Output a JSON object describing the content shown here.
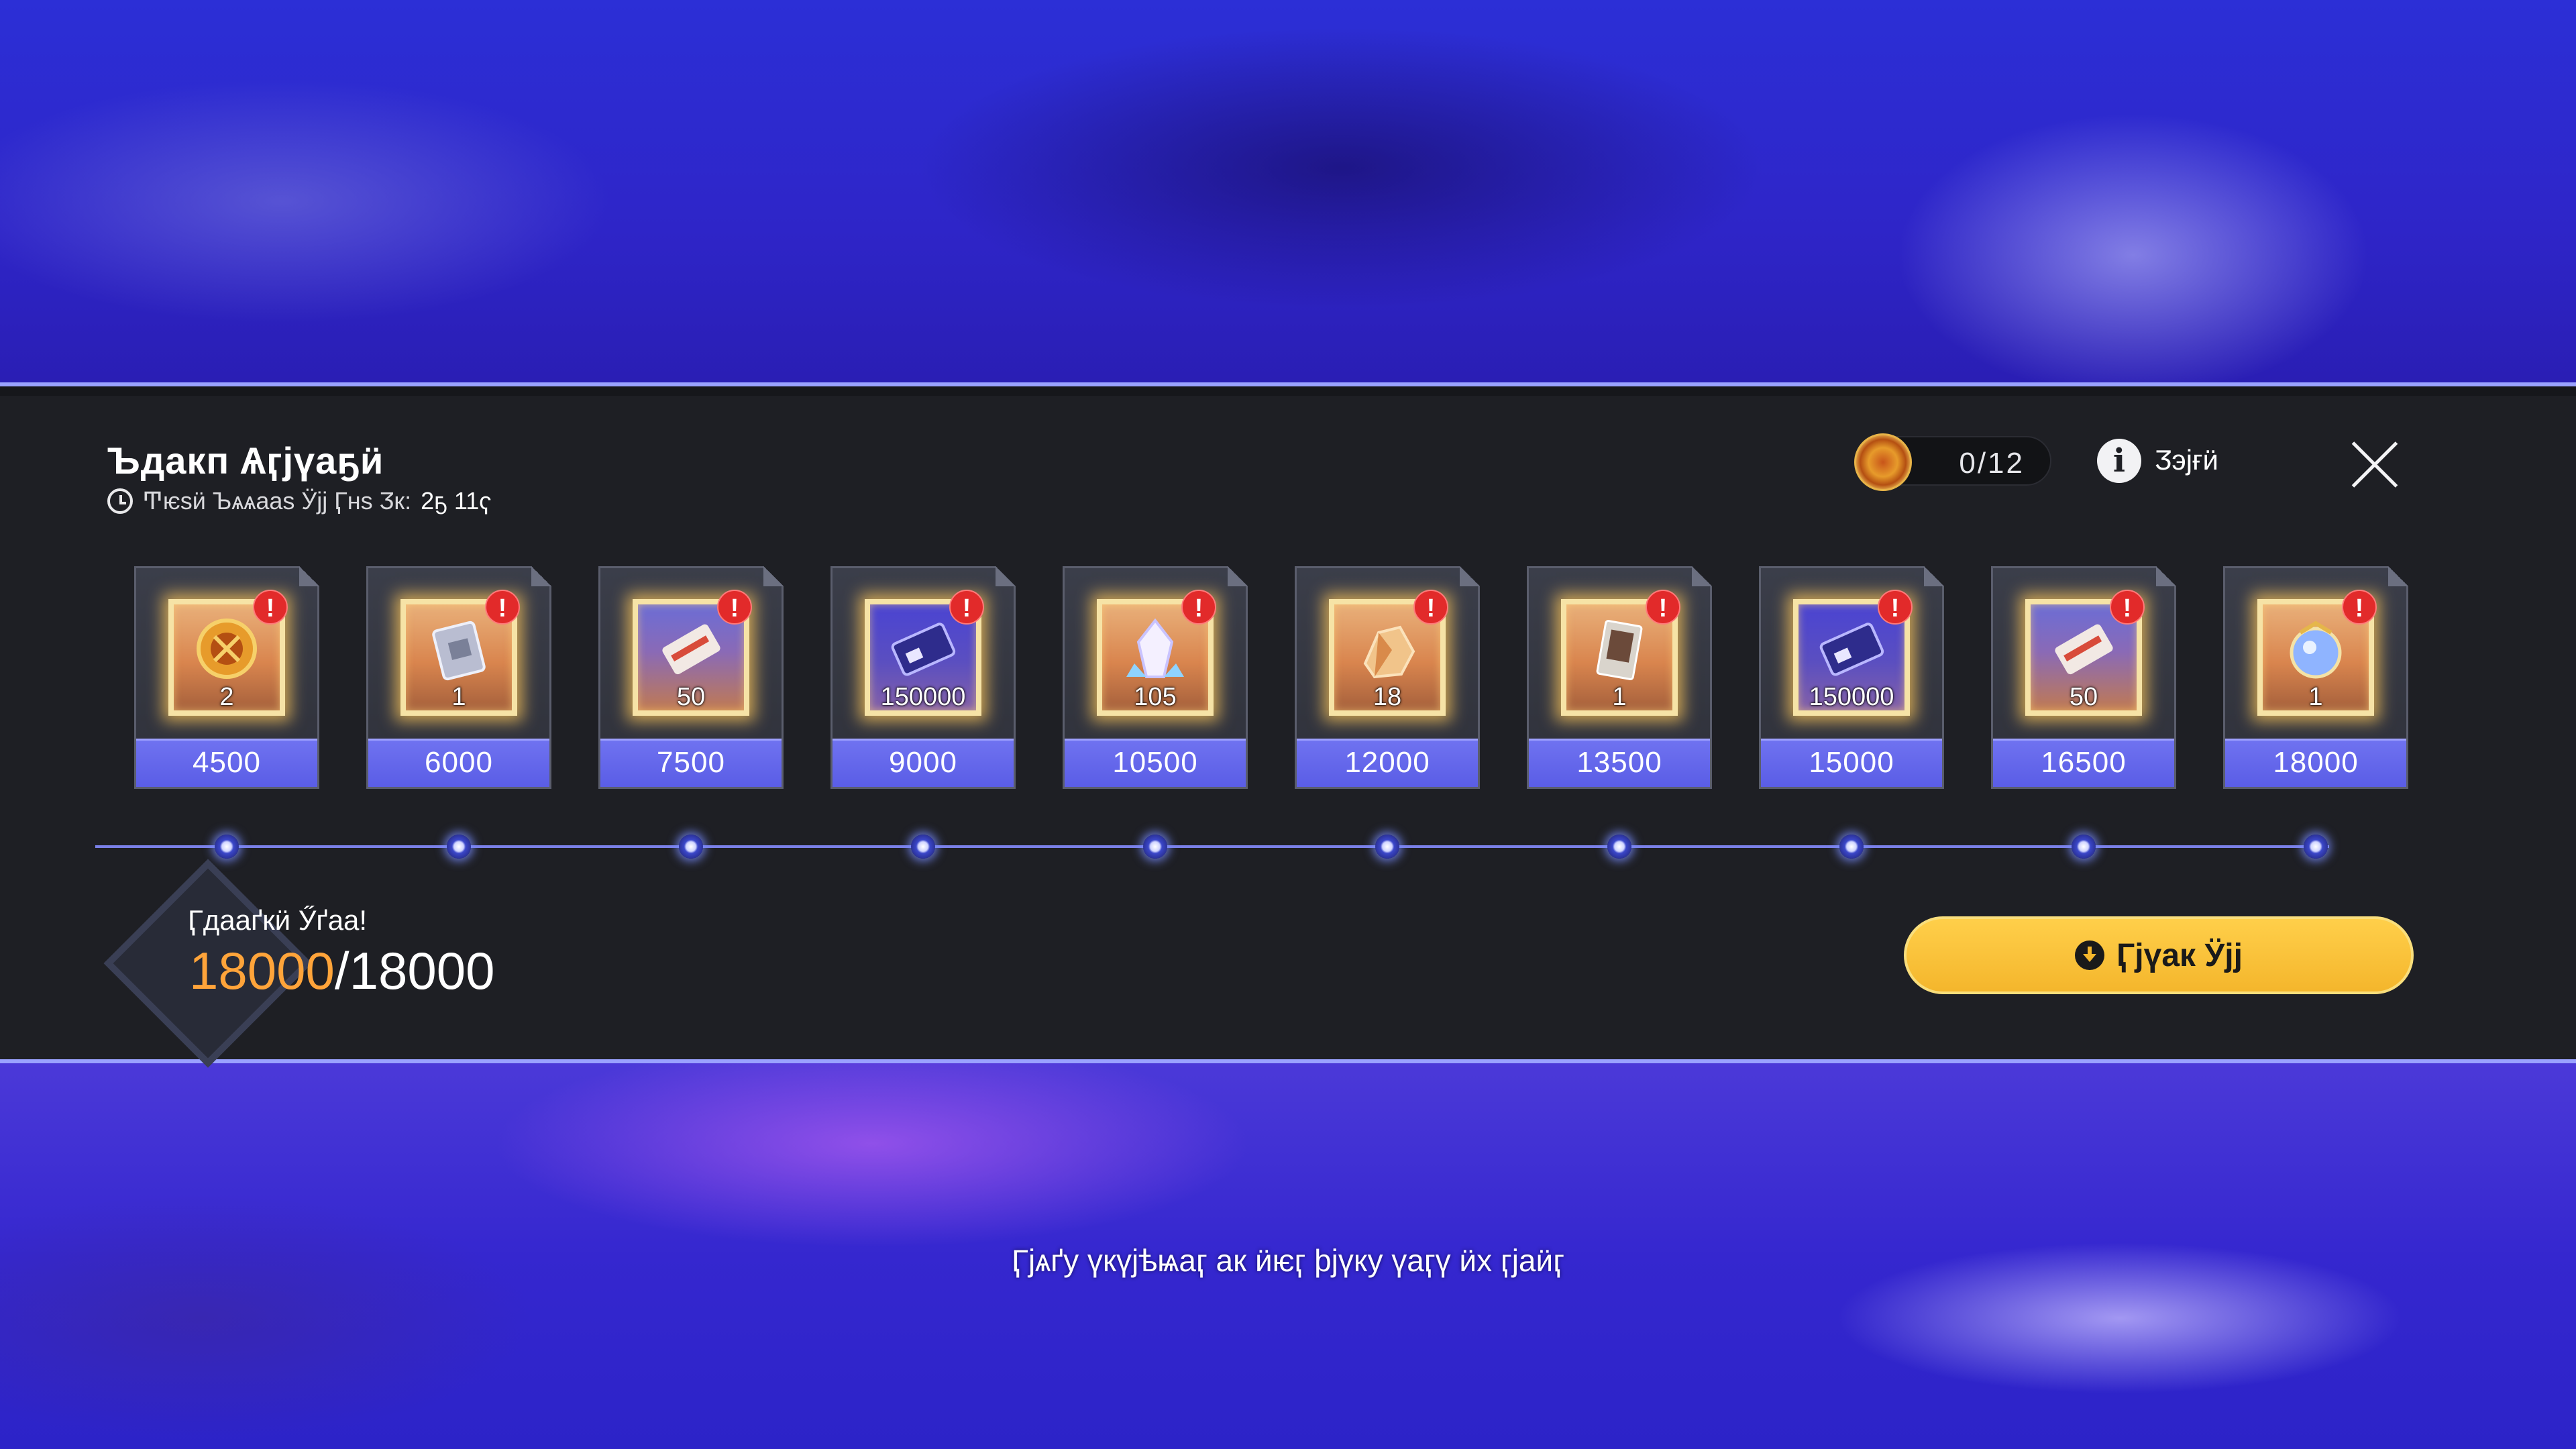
{
  "event": {
    "title": "Ъдакп Ѧӷjүаҕӥ",
    "timer_label": "Ͳѥѕӥ Ъѧѧааѕ Ӱјј Ӷнѕ Ӡк:",
    "timer_value": "2ҕ 11ҁ",
    "tokens": "0/12",
    "info_label": "Ӡэјғӥ"
  },
  "rewards": [
    {
      "qty": "2",
      "points": "4500",
      "icon": "emblem-coin-icon",
      "tone": "orange"
    },
    {
      "qty": "1",
      "points": "6000",
      "icon": "silver-token-icon",
      "tone": "orange"
    },
    {
      "qty": "50",
      "points": "7500",
      "icon": "ticket-icon",
      "tone": "blue"
    },
    {
      "qty": "150000",
      "points": "9000",
      "icon": "credit-chip-icon",
      "tone": "purple"
    },
    {
      "qty": "105",
      "points": "10500",
      "icon": "crystal-icon",
      "tone": "orange"
    },
    {
      "qty": "18",
      "points": "12000",
      "icon": "ore-icon",
      "tone": "orange"
    },
    {
      "qty": "1",
      "points": "13500",
      "icon": "device-card-icon",
      "tone": "orange"
    },
    {
      "qty": "150000",
      "points": "15000",
      "icon": "credit-chip-icon",
      "tone": "purple"
    },
    {
      "qty": "50",
      "points": "16500",
      "icon": "ticket-icon",
      "tone": "blue"
    },
    {
      "qty": "1",
      "points": "18000",
      "icon": "orb-icon",
      "tone": "orange"
    }
  ],
  "progress": {
    "label": "Ӷдааґкӥ Ӳґаа!",
    "current": "18000",
    "separator": "/",
    "total": "18000"
  },
  "claim_button": {
    "label": "Ӷјүак Ӱјј"
  },
  "footer_hint": "Ӷјѧґу үкүјѣѩаӷ ак ӥѥӷ ϸјүку үаӷү ӥх ӷјаӥӷ",
  "colors": {
    "accent_orange": "#ffa43a",
    "claim_yellow": "#f4b62c",
    "points_bar": "#5a5de6",
    "badge_red": "#e22a2a"
  }
}
